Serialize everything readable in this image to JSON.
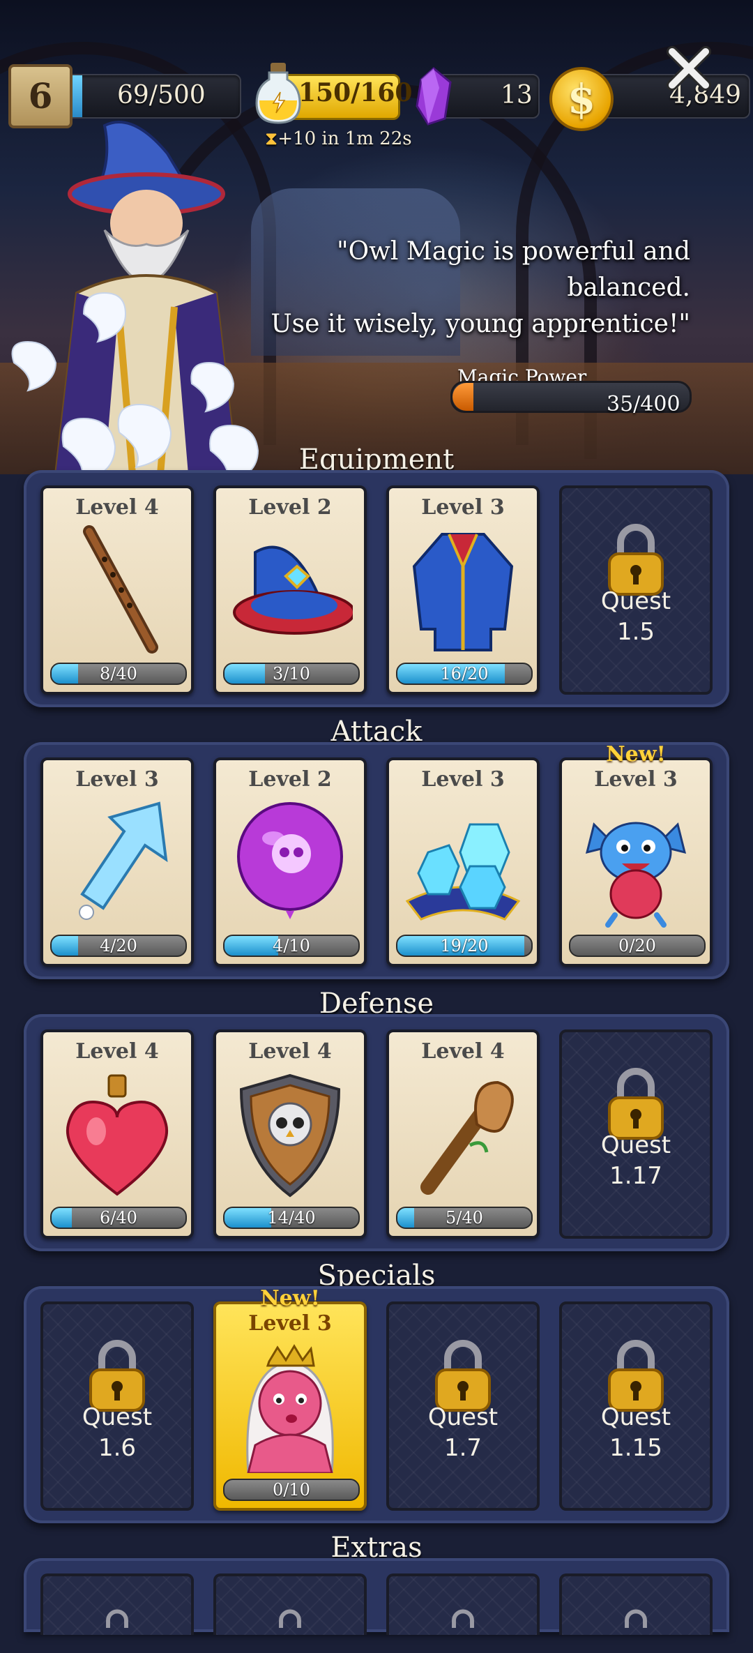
{
  "topbar": {
    "player_level": "6",
    "xp": "69/500",
    "xp_fraction": 0.138,
    "energy": "150/160",
    "energy_timer": "+10 in 1m 22s",
    "gems": "13",
    "coin_symbol": "$",
    "coins": "4,849"
  },
  "hero": {
    "quote_line1": "\"Owl Magic is powerful and balanced.",
    "quote_line2": "Use it wisely, young apprentice!\"",
    "magic_power_label": "Magic Power",
    "magic_power_value": "35/400",
    "magic_power_fraction": 0.0875
  },
  "sections": {
    "equipment": {
      "title": "Equipment",
      "cards": [
        {
          "level": "Level 4",
          "progress": "8/40",
          "fraction": 0.2,
          "icon": "flute-wand-icon"
        },
        {
          "level": "Level 2",
          "progress": "3/10",
          "fraction": 0.3,
          "icon": "wizard-hat-icon"
        },
        {
          "level": "Level 3",
          "progress": "16/20",
          "fraction": 0.8,
          "icon": "wizard-robe-icon"
        }
      ],
      "locked": {
        "quest_label": "Quest",
        "quest_number": "1.5"
      }
    },
    "attack": {
      "title": "Attack",
      "cards": [
        {
          "level": "Level 3",
          "progress": "4/20",
          "fraction": 0.2,
          "icon": "ice-arrow-icon"
        },
        {
          "level": "Level 2",
          "progress": "4/10",
          "fraction": 0.4,
          "icon": "skull-balloon-icon"
        },
        {
          "level": "Level 3",
          "progress": "19/20",
          "fraction": 0.95,
          "icon": "ice-crystals-icon"
        },
        {
          "level": "Level 3",
          "progress": "0/20",
          "fraction": 0.0,
          "icon": "blue-imp-icon",
          "new": "New!"
        }
      ]
    },
    "defense": {
      "title": "Defense",
      "cards": [
        {
          "level": "Level 4",
          "progress": "6/40",
          "fraction": 0.15,
          "icon": "heart-potion-icon"
        },
        {
          "level": "Level 4",
          "progress": "14/40",
          "fraction": 0.35,
          "icon": "owl-shield-icon"
        },
        {
          "level": "Level 4",
          "progress": "5/40",
          "fraction": 0.125,
          "icon": "wooden-club-icon"
        }
      ],
      "locked": {
        "quest_label": "Quest",
        "quest_number": "1.17"
      }
    },
    "specials": {
      "title": "Specials",
      "locked1": {
        "quest_label": "Quest",
        "quest_number": "1.6"
      },
      "card": {
        "level": "Level 3",
        "progress": "0/10",
        "fraction": 0.0,
        "icon": "pink-queen-icon",
        "new": "New!"
      },
      "locked2": {
        "quest_label": "Quest",
        "quest_number": "1.7"
      },
      "locked3": {
        "quest_label": "Quest",
        "quest_number": "1.15"
      }
    },
    "extras": {
      "title": "Extras"
    }
  },
  "colors": {
    "panel": "#2b3560",
    "card": "#efe2c6",
    "progress": "#1c90cc",
    "gold": "#ffd23a"
  }
}
